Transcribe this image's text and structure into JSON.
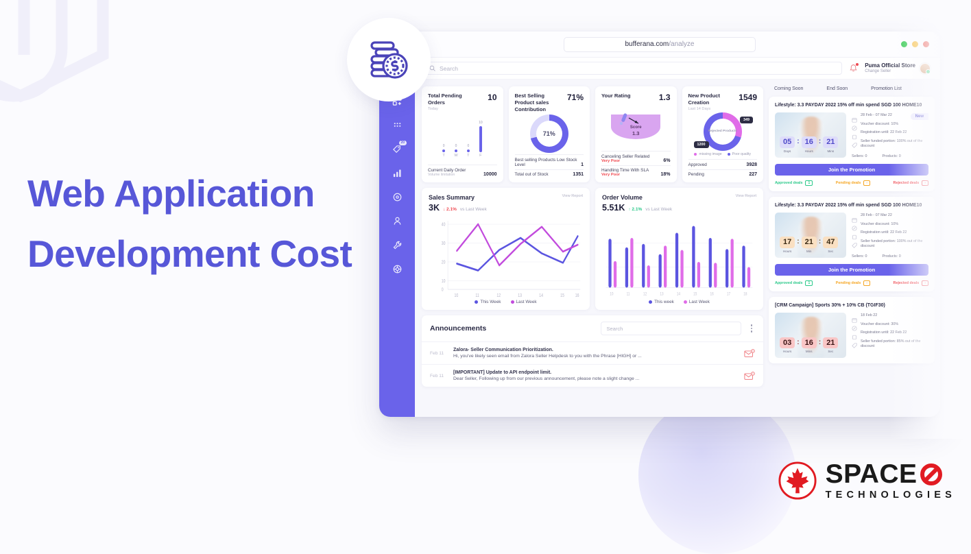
{
  "headline": "Web Application Development Cost",
  "brand": {
    "name": "SPACE",
    "sub": "TECHNOLOGIES",
    "accent": "#5757d8",
    "red": "#e11b22"
  },
  "browser": {
    "url_main": "bufferana.com",
    "url_path": "/analyze",
    "window_dots": [
      "#2fc84b",
      "#f7bd3f",
      "#ea4a3f"
    ]
  },
  "topbar": {
    "search_placeholder": "Search",
    "user_name": "Puma Official Store",
    "user_sub": "Change Seller"
  },
  "rail": {
    "badge": "20",
    "items": [
      "dashboard-grid-icon",
      "apps-dots-icon",
      "tag-discount-icon",
      "bar-chart-icon",
      "target-icon",
      "user-icon",
      "wrench-icon",
      "settings-gear-icon"
    ]
  },
  "kpi": [
    {
      "title": "Total Pending Orders",
      "subtitle": "Today",
      "value": "10",
      "foot": [
        {
          "label": "Current Daily Order",
          "sublabel": "Volume limitation",
          "value": "10000"
        }
      ]
    },
    {
      "title": "Best Selling Product sales Contribution",
      "value": "71%",
      "donut_center": "71%",
      "foot": [
        {
          "label": "Best selling Products Low Stock Level",
          "value": "1"
        },
        {
          "label": "Total out of Stock",
          "value": "1351"
        }
      ]
    },
    {
      "title": "Your Rating",
      "value": "1.3",
      "gauge_label": "Score",
      "gauge_value": "1.3",
      "foot": [
        {
          "label": "Canceling Seller Related",
          "value": "6%",
          "status": "Very Poor"
        },
        {
          "label": "Handling Time With SLA",
          "value": "18%",
          "status": "Very Poor"
        }
      ]
    },
    {
      "title": "New Product Creation",
      "subtitle": "Last 14 Days",
      "value": "1549",
      "donut_center": "Rejected Products",
      "tag_top": "349",
      "tag_bottom": "1200",
      "legend": [
        {
          "label": "missing image",
          "color": "#e06ce8"
        },
        {
          "label": "Poor quality",
          "color": "#6a63ea"
        }
      ],
      "foot": [
        {
          "label": "Approved",
          "value": "3928"
        },
        {
          "label": "Pending",
          "value": "227"
        }
      ]
    }
  ],
  "pending_orders_chart": {
    "type": "bar",
    "categories": [
      "T",
      "W",
      "T",
      "F"
    ],
    "values": [
      0,
      0,
      0,
      10
    ],
    "value_labels": [
      "0",
      "0",
      "0",
      "10"
    ]
  },
  "chart_data": [
    {
      "type": "line",
      "title": "Sales Summary",
      "kpi": "3K",
      "delta": "2.1%",
      "delta_dir": "down",
      "delta_color": "#ef4a52",
      "vs": "vs Last Week",
      "link": "View Report",
      "x": [
        "10",
        "11",
        "12",
        "13",
        "14",
        "15",
        "16"
      ],
      "ylim": [
        0,
        40
      ],
      "yticks": [
        "0",
        "10",
        "20",
        "30",
        "40"
      ],
      "series": [
        {
          "name": "This Week",
          "color": "#5b55e0",
          "values": [
            14,
            11,
            22,
            29,
            20,
            15,
            30
          ]
        },
        {
          "name": "Last Week",
          "color": "#c24bdd",
          "values": [
            21,
            38,
            14,
            26,
            36,
            22,
            26
          ]
        }
      ],
      "legend": [
        "This Week",
        "Last Week"
      ]
    },
    {
      "type": "bar",
      "title": "Order Volume",
      "kpi": "5.51K",
      "delta": "2.1%",
      "delta_dir": "up",
      "delta_color": "#2bc98a",
      "vs": "vs Last Week",
      "link": "View Report",
      "x": [
        "10",
        "11",
        "12",
        "13",
        "14",
        "15",
        "16",
        "17",
        "18"
      ],
      "ylim": [
        0,
        100
      ],
      "series": [
        {
          "name": "This week",
          "color": "#5b55e0",
          "values": [
            72,
            60,
            65,
            50,
            82,
            92,
            74,
            58,
            62
          ]
        },
        {
          "name": "Last Week",
          "color": "#e06ce8",
          "values": [
            40,
            74,
            32,
            63,
            56,
            39,
            38,
            73,
            30
          ]
        }
      ],
      "legend": [
        "This week",
        "Last Week"
      ]
    }
  ],
  "announcements": {
    "title": "Announcements",
    "search_placeholder": "Search",
    "items": [
      {
        "date": "Feb 11",
        "title": "Zalora- Seller Communication Prioritization.",
        "desc": "Hi, you've likely seen email from Zalora Seller Helpdesk to you with the Phrase [HIGH] or ..."
      },
      {
        "date": "Feb 11",
        "title": "[IMPORTANT] Update to API endpoint limit.",
        "desc": "Dear Seller, Following up from our previous announcement, please note a slight change ..."
      }
    ]
  },
  "promo": {
    "tabs": [
      "Coming Soon",
      "End Soon",
      "Promotion List"
    ],
    "cards": [
      {
        "title": "Lifestyle:  3.3 PAYDAY 2022   15% off min spend SGD 100   HOME10",
        "badge": "New",
        "timer": {
          "values": [
            "05",
            "16",
            "21"
          ],
          "labels": [
            "Days",
            "Hours",
            "Mins"
          ],
          "theme": "purple"
        },
        "info": [
          "28 Feb - 07 Mar 22",
          "Voucher discount: 10%",
          "Registration until: 22 Feb 22",
          "Seller funded portion: 100% out of the discount"
        ],
        "sellers": "Sellers:  0",
        "products": "Products:  0",
        "join_label": "Join the Promotion",
        "deals": [
          {
            "label": "Approved deals",
            "count": "1",
            "color": "#2bc98a"
          },
          {
            "label": "Pending deals",
            "count": "-",
            "color": "#f5a623"
          },
          {
            "label": "Rejected deals",
            "count": "-",
            "color": "#ef4a52"
          }
        ]
      },
      {
        "title": "Lifestyle:  3.3 PAYDAY 2022   15% off min spend SGD 100   HOME10",
        "badge": "",
        "timer": {
          "values": [
            "17",
            "21",
            "47"
          ],
          "labels": [
            "Hours",
            "Min",
            "Sec"
          ],
          "theme": "orange"
        },
        "info": [
          "28 Feb - 07 Mar 22",
          "Voucher discount: 10%",
          "Registration until: 22 Feb 22",
          "Seller funded portion: 100% out of the discount"
        ],
        "sellers": "Sellers:  0",
        "products": "Products:  0",
        "join_label": "Join the Promotion",
        "deals": [
          {
            "label": "Approved deals",
            "count": "1",
            "color": "#2bc98a"
          },
          {
            "label": "Pending deals",
            "count": "-",
            "color": "#f5a623"
          },
          {
            "label": "Rejected deals",
            "count": "-",
            "color": "#ef4a52"
          }
        ]
      },
      {
        "title": "[CRM Campaign] Sports 30% + 10% CB (TGIF30)",
        "badge": "",
        "timer": {
          "values": [
            "03",
            "16",
            "21"
          ],
          "labels": [
            "Hours",
            "Mins",
            "Sec"
          ],
          "theme": "red"
        },
        "info": [
          "18 Feb 22",
          "Voucher discount: 30%",
          "Registration until: 22 Feb 22",
          "Seller funded portion: 85% out of the discount"
        ],
        "sellers": "",
        "products": "",
        "join_label": "",
        "deals": []
      }
    ]
  }
}
